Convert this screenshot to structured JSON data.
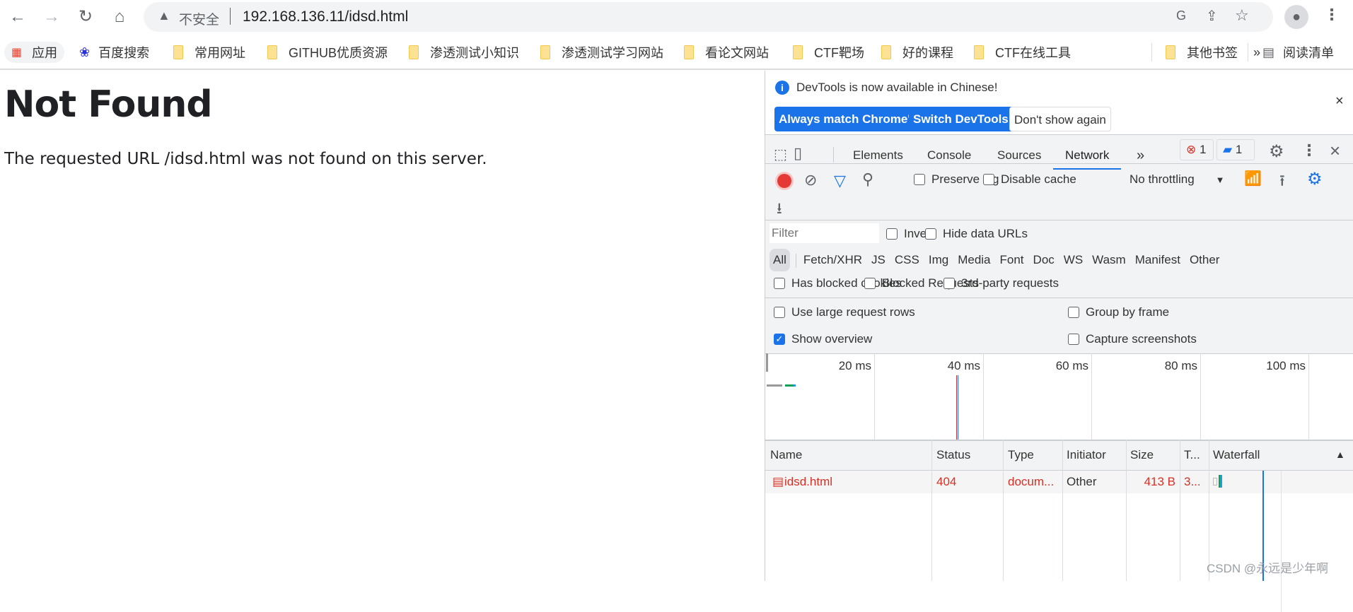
{
  "browser": {
    "security_label": "不安全",
    "url": "192.168.136.11/idsd.html",
    "bookmarks": [
      {
        "label": "应用",
        "icon": "apps-grid-icon"
      },
      {
        "label": "百度搜索",
        "icon": "baidu-icon"
      },
      {
        "label": "常用网址",
        "icon": "folder-icon"
      },
      {
        "label": "GITHUB优质资源",
        "icon": "folder-icon"
      },
      {
        "label": "渗透测试小知识",
        "icon": "folder-icon"
      },
      {
        "label": "渗透测试学习网站",
        "icon": "folder-icon"
      },
      {
        "label": "看论文网站",
        "icon": "folder-icon"
      },
      {
        "label": "CTF靶场",
        "icon": "folder-icon"
      },
      {
        "label": "好的课程",
        "icon": "folder-icon"
      },
      {
        "label": "CTF在线工具",
        "icon": "folder-icon"
      }
    ],
    "overflow": "»",
    "other_bookmarks": "其他书签",
    "reading_list": "阅读清单"
  },
  "page": {
    "title": "Not Found",
    "message": "The requested URL /idsd.html was not found on this server."
  },
  "devtools": {
    "infobar": {
      "message": "DevTools is now available in Chinese!",
      "btn_match": "Always match Chrome's language",
      "btn_switch": "Switch DevTools to Chinese",
      "btn_dont": "Don't show again"
    },
    "tabs": [
      "Elements",
      "Console",
      "Sources",
      "Network"
    ],
    "active_tab": "Network",
    "more": "»",
    "error_count": "1",
    "message_count": "1",
    "toolbar": {
      "preserve_log": "Preserve log",
      "disable_cache": "Disable cache",
      "throttling": "No throttling"
    },
    "filter": {
      "placeholder": "Filter",
      "invert": "Invert",
      "hide_data_urls": "Hide data URLs"
    },
    "types": [
      "All",
      "Fetch/XHR",
      "JS",
      "CSS",
      "Img",
      "Media",
      "Font",
      "Doc",
      "WS",
      "Wasm",
      "Manifest",
      "Other"
    ],
    "blocked": {
      "cookies": "Has blocked cookies",
      "requests": "Blocked Requests",
      "third_party": "3rd-party requests"
    },
    "settings": {
      "large_rows": "Use large request rows",
      "group_frame": "Group by frame",
      "show_overview": "Show overview",
      "capture": "Capture screenshots",
      "show_overview_checked": true
    },
    "overview_ticks": [
      "20 ms",
      "40 ms",
      "60 ms",
      "80 ms",
      "100 ms"
    ],
    "columns": [
      "Name",
      "Status",
      "Type",
      "Initiator",
      "Size",
      "T...",
      "Waterfall"
    ],
    "rows": [
      {
        "name": "idsd.html",
        "status": "404",
        "type": "docum...",
        "initiator": "Other",
        "size": "413 B",
        "time": "3..."
      }
    ]
  },
  "watermark": "CSDN @永远是少年啊"
}
